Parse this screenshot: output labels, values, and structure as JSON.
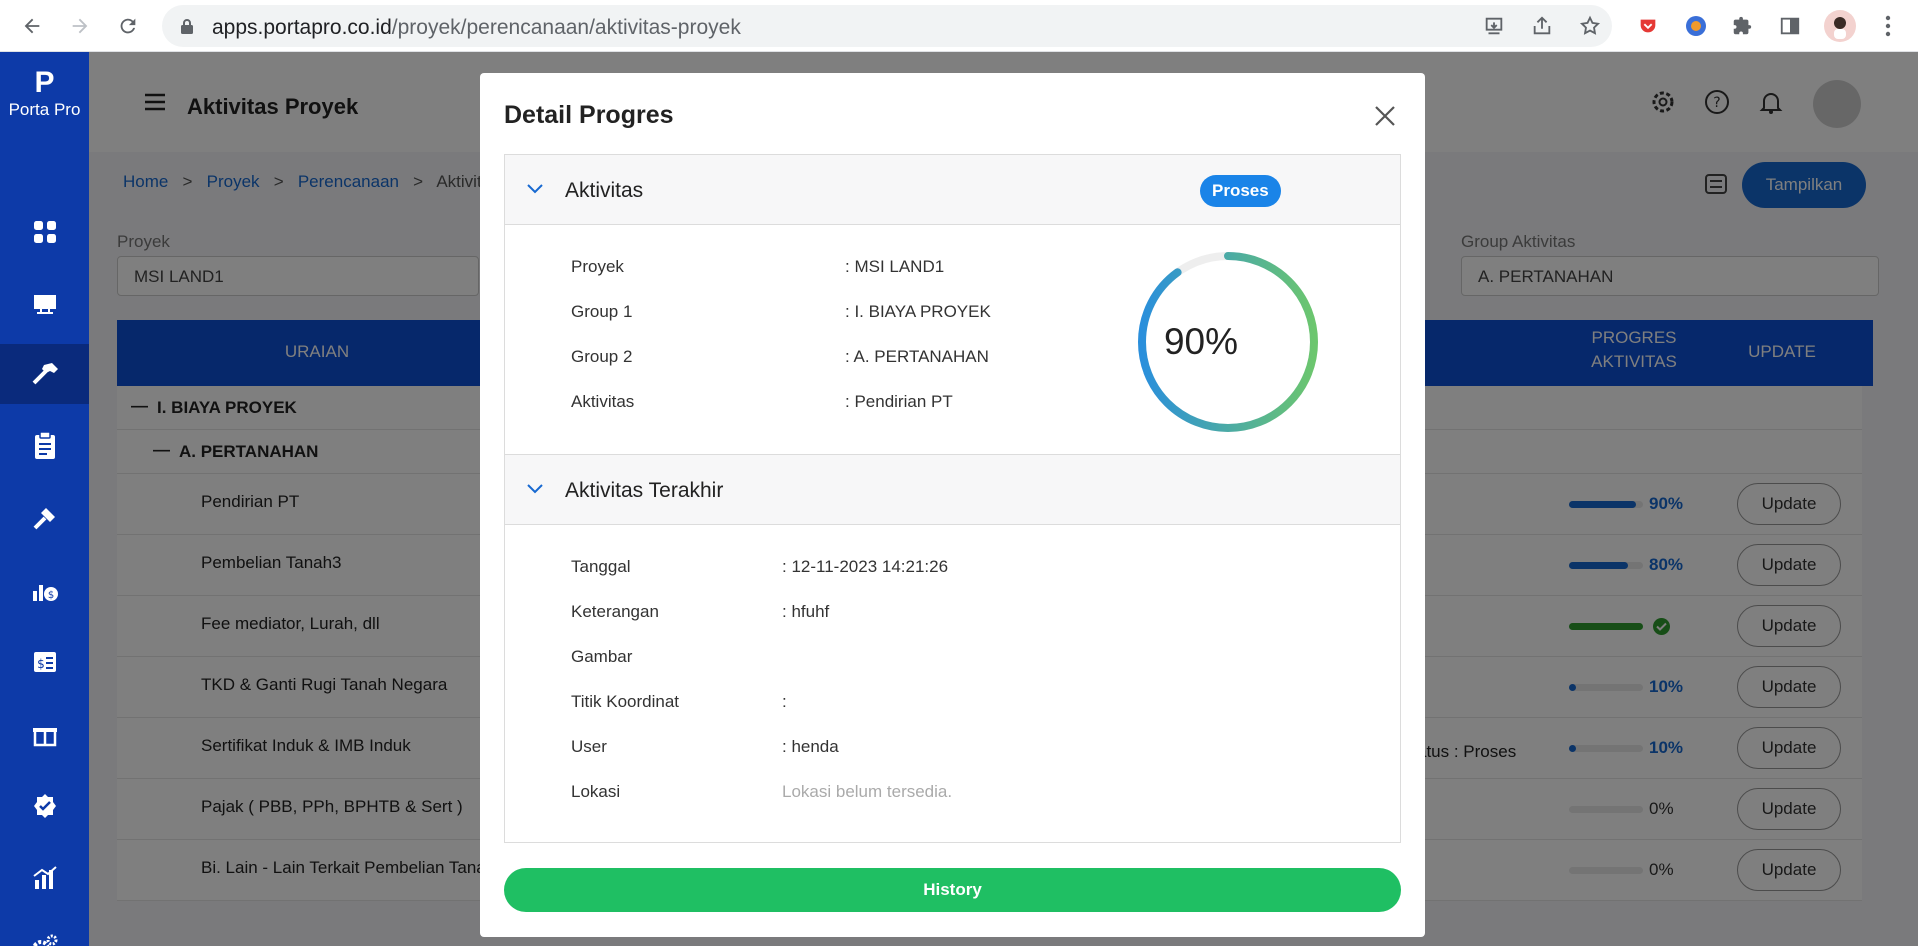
{
  "browser": {
    "url_domain": "apps.portapro.co.id",
    "url_path": "/proyek/perencanaan/aktivitas-proyek"
  },
  "app": {
    "logo_mark": "P",
    "logo_text": "Porta Pro",
    "page_title": "Aktivitas Proyek",
    "breadcrumb": [
      "Home",
      ">",
      "Proyek",
      ">",
      "Perencanaan",
      ">",
      "Aktivita"
    ],
    "tampilkan_label": "Tampilkan",
    "filters": {
      "proyek_label": "Proyek",
      "proyek_value": "MSI LAND1",
      "group_label": "Group Aktivitas",
      "group_value": "A. PERTANAHAN"
    },
    "table": {
      "headers": {
        "uraian": "URAIAN",
        "progres_1": "PROGRES",
        "progres_2": "AKTIVITAS",
        "update": "UPDATE"
      },
      "group1": "I. BIAYA PROYEK",
      "group2": "A. PERTANAHAN",
      "status_fragment": "atus : Proses",
      "rows": [
        {
          "label": "Pendirian PT",
          "progress": 0.9,
          "pct": "90%",
          "color": "#1769d1",
          "update": "Update"
        },
        {
          "label": "Pembelian Tanah3",
          "progress": 0.8,
          "pct": "80%",
          "color": "#1769d1",
          "update": "Update"
        },
        {
          "label": "Fee mediator, Lurah, dll",
          "progress": 1.0,
          "pct": "",
          "color": "#2e9d2e",
          "update": "Update"
        },
        {
          "label": "TKD & Ganti Rugi Tanah Negara",
          "progress": 0.1,
          "pct": "10%",
          "color": "#1769d1",
          "update": "Update"
        },
        {
          "label": "Sertifikat Induk & IMB Induk",
          "progress": 0.1,
          "pct": "10%",
          "color": "#1769d1",
          "update": "Update"
        },
        {
          "label": "Pajak ( PBB, PPh, BPHTB & Sert )",
          "progress": 0,
          "pct": "0%",
          "color": "#1769d1",
          "update": "Update"
        },
        {
          "label": "Bi. Lain - Lain Terkait Pembelian Tana",
          "progress": 0,
          "pct": "0%",
          "color": "#1769d1",
          "update": "Update"
        }
      ]
    }
  },
  "modal": {
    "title": "Detail Progres",
    "aktivitas": {
      "heading": "Aktivitas",
      "badge": "Proses",
      "progress": 0.9,
      "progress_label": "90%",
      "fields": [
        {
          "key": "Proyek",
          "value": ": MSI LAND1"
        },
        {
          "key": "Group 1",
          "value": ": I. BIAYA PROYEK"
        },
        {
          "key": "Group 2",
          "value": ": A. PERTANAHAN"
        },
        {
          "key": "Aktivitas",
          "value": ": Pendirian PT"
        }
      ]
    },
    "terakhir": {
      "heading": "Aktivitas Terakhir",
      "fields": [
        {
          "key": "Tanggal",
          "value": ": 12-11-2023 14:21:26"
        },
        {
          "key": "Keterangan",
          "value": ": hfuhf"
        },
        {
          "key": "Gambar",
          "value": ""
        },
        {
          "key": "Titik Koordinat",
          "value": ":"
        },
        {
          "key": "User",
          "value": ": henda"
        },
        {
          "key": "Lokasi",
          "value": "Lokasi belum tersedia."
        }
      ]
    },
    "history_label": "History"
  },
  "colors": {
    "sidebar": "#0d3aa8",
    "primary": "#1769d1",
    "badge": "#1a84e8",
    "history": "#1fbf63"
  }
}
